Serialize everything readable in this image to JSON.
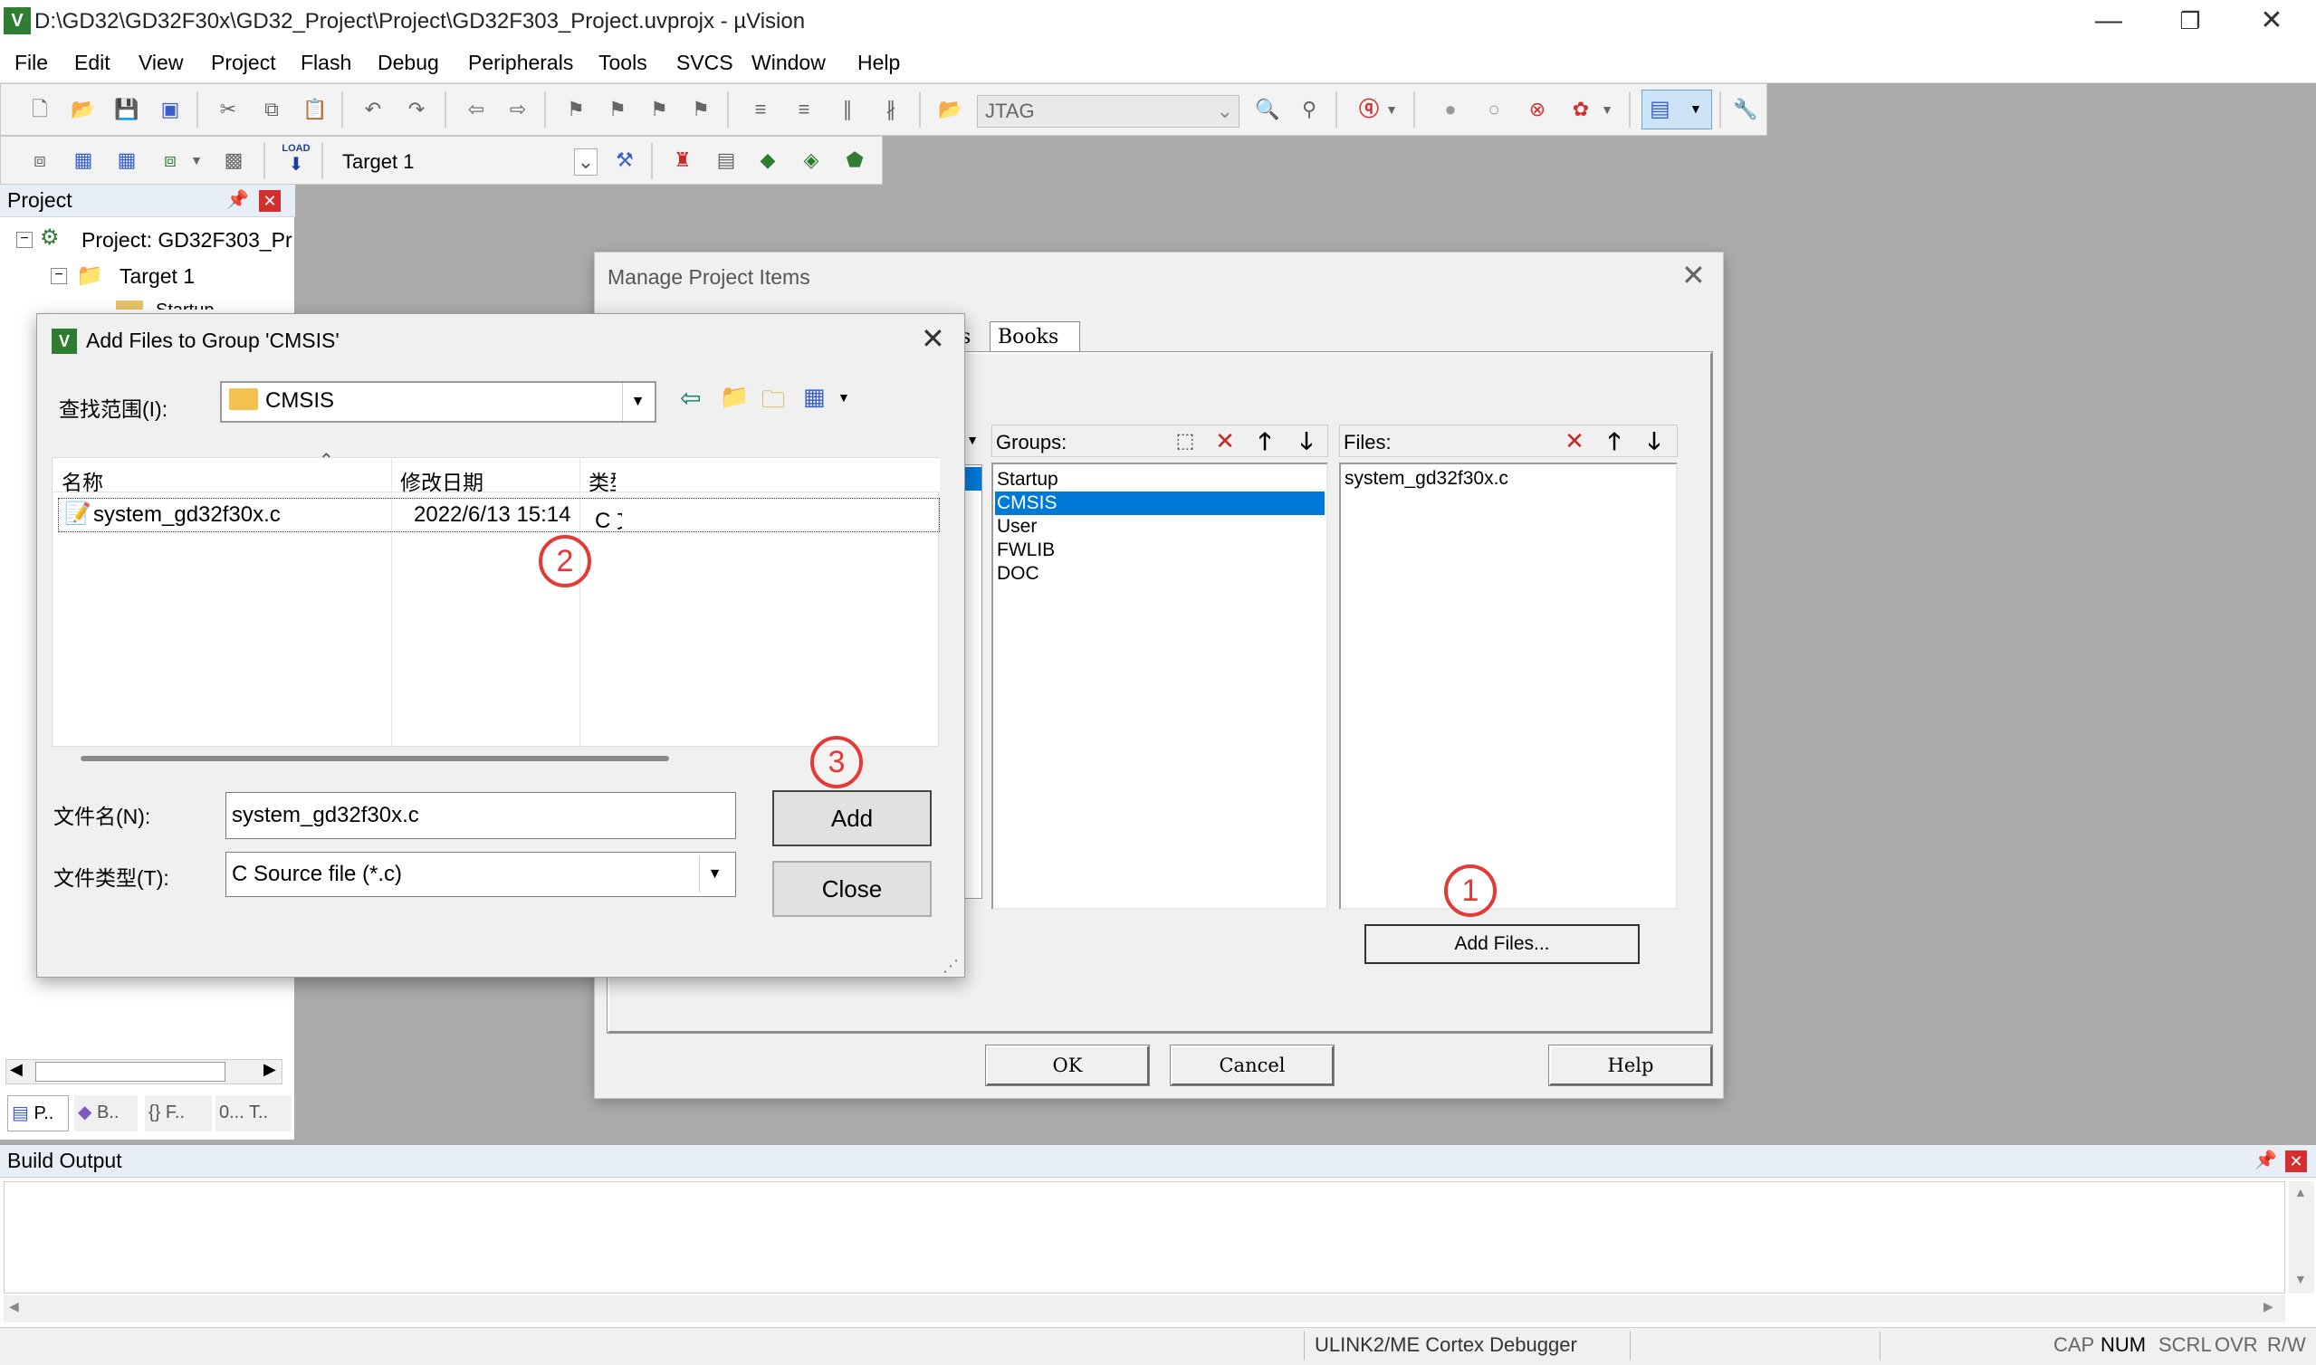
{
  "window": {
    "title": "D:\\GD32\\GD32F30x\\GD32_Project\\Project\\GD32F303_Project.uvprojx - µVision",
    "minimize": "—",
    "restore": "❐",
    "close": "✕"
  },
  "menu": [
    "File",
    "Edit",
    "View",
    "Project",
    "Flash",
    "Debug",
    "Peripherals",
    "Tools",
    "SVCS",
    "Window",
    "Help"
  ],
  "toolbar": {
    "debugger_combo": "JTAG",
    "target_combo": "Target 1",
    "load_label": "LOAD"
  },
  "project_pane": {
    "header": "Project",
    "tree": {
      "root": "Project: GD32F303_Pr",
      "target": "Target 1",
      "group_partial": "Startup"
    },
    "tabs": [
      "P..",
      "B..",
      "{} F..",
      "0... T.."
    ]
  },
  "manage_dialog": {
    "title": "Manage Project Items",
    "tab_partial": "s",
    "tab_books": "Books",
    "groups_label": "Groups:",
    "groups": [
      "Startup",
      "CMSIS",
      "User",
      "FWLIB",
      "DOC"
    ],
    "selected_group": "CMSIS",
    "files_label": "Files:",
    "files": [
      "system_gd32f30x.c"
    ],
    "add_files_button": "Add Files...",
    "ok_button": "OK",
    "cancel_button": "Cancel",
    "help_button": "Help"
  },
  "add_files_dialog": {
    "title": "Add Files to Group 'CMSIS'",
    "look_in_label": "查找范围(I):",
    "look_in_value": "CMSIS",
    "col_name": "名称",
    "col_date": "修改日期",
    "col_type": "类型",
    "rows": [
      {
        "name": "system_gd32f30x.c",
        "date": "2022/6/13 15:14",
        "type": "C 文"
      }
    ],
    "filename_label": "文件名(N):",
    "filename_value": "system_gd32f30x.c",
    "filetype_label": "文件类型(T):",
    "filetype_value": "C Source file (*.c)",
    "add_button": "Add",
    "close_button": "Close"
  },
  "annotations": [
    "1",
    "2",
    "3"
  ],
  "build_output": {
    "header": "Build Output"
  },
  "status": {
    "debugger": "ULINK2/ME Cortex Debugger",
    "cap": "CAP",
    "num": "NUM",
    "scrl": "SCRL",
    "ovr": "OVR",
    "rw": "R/W"
  },
  "colors": {
    "selection": "#0078d7",
    "annotation": "#e53935"
  }
}
